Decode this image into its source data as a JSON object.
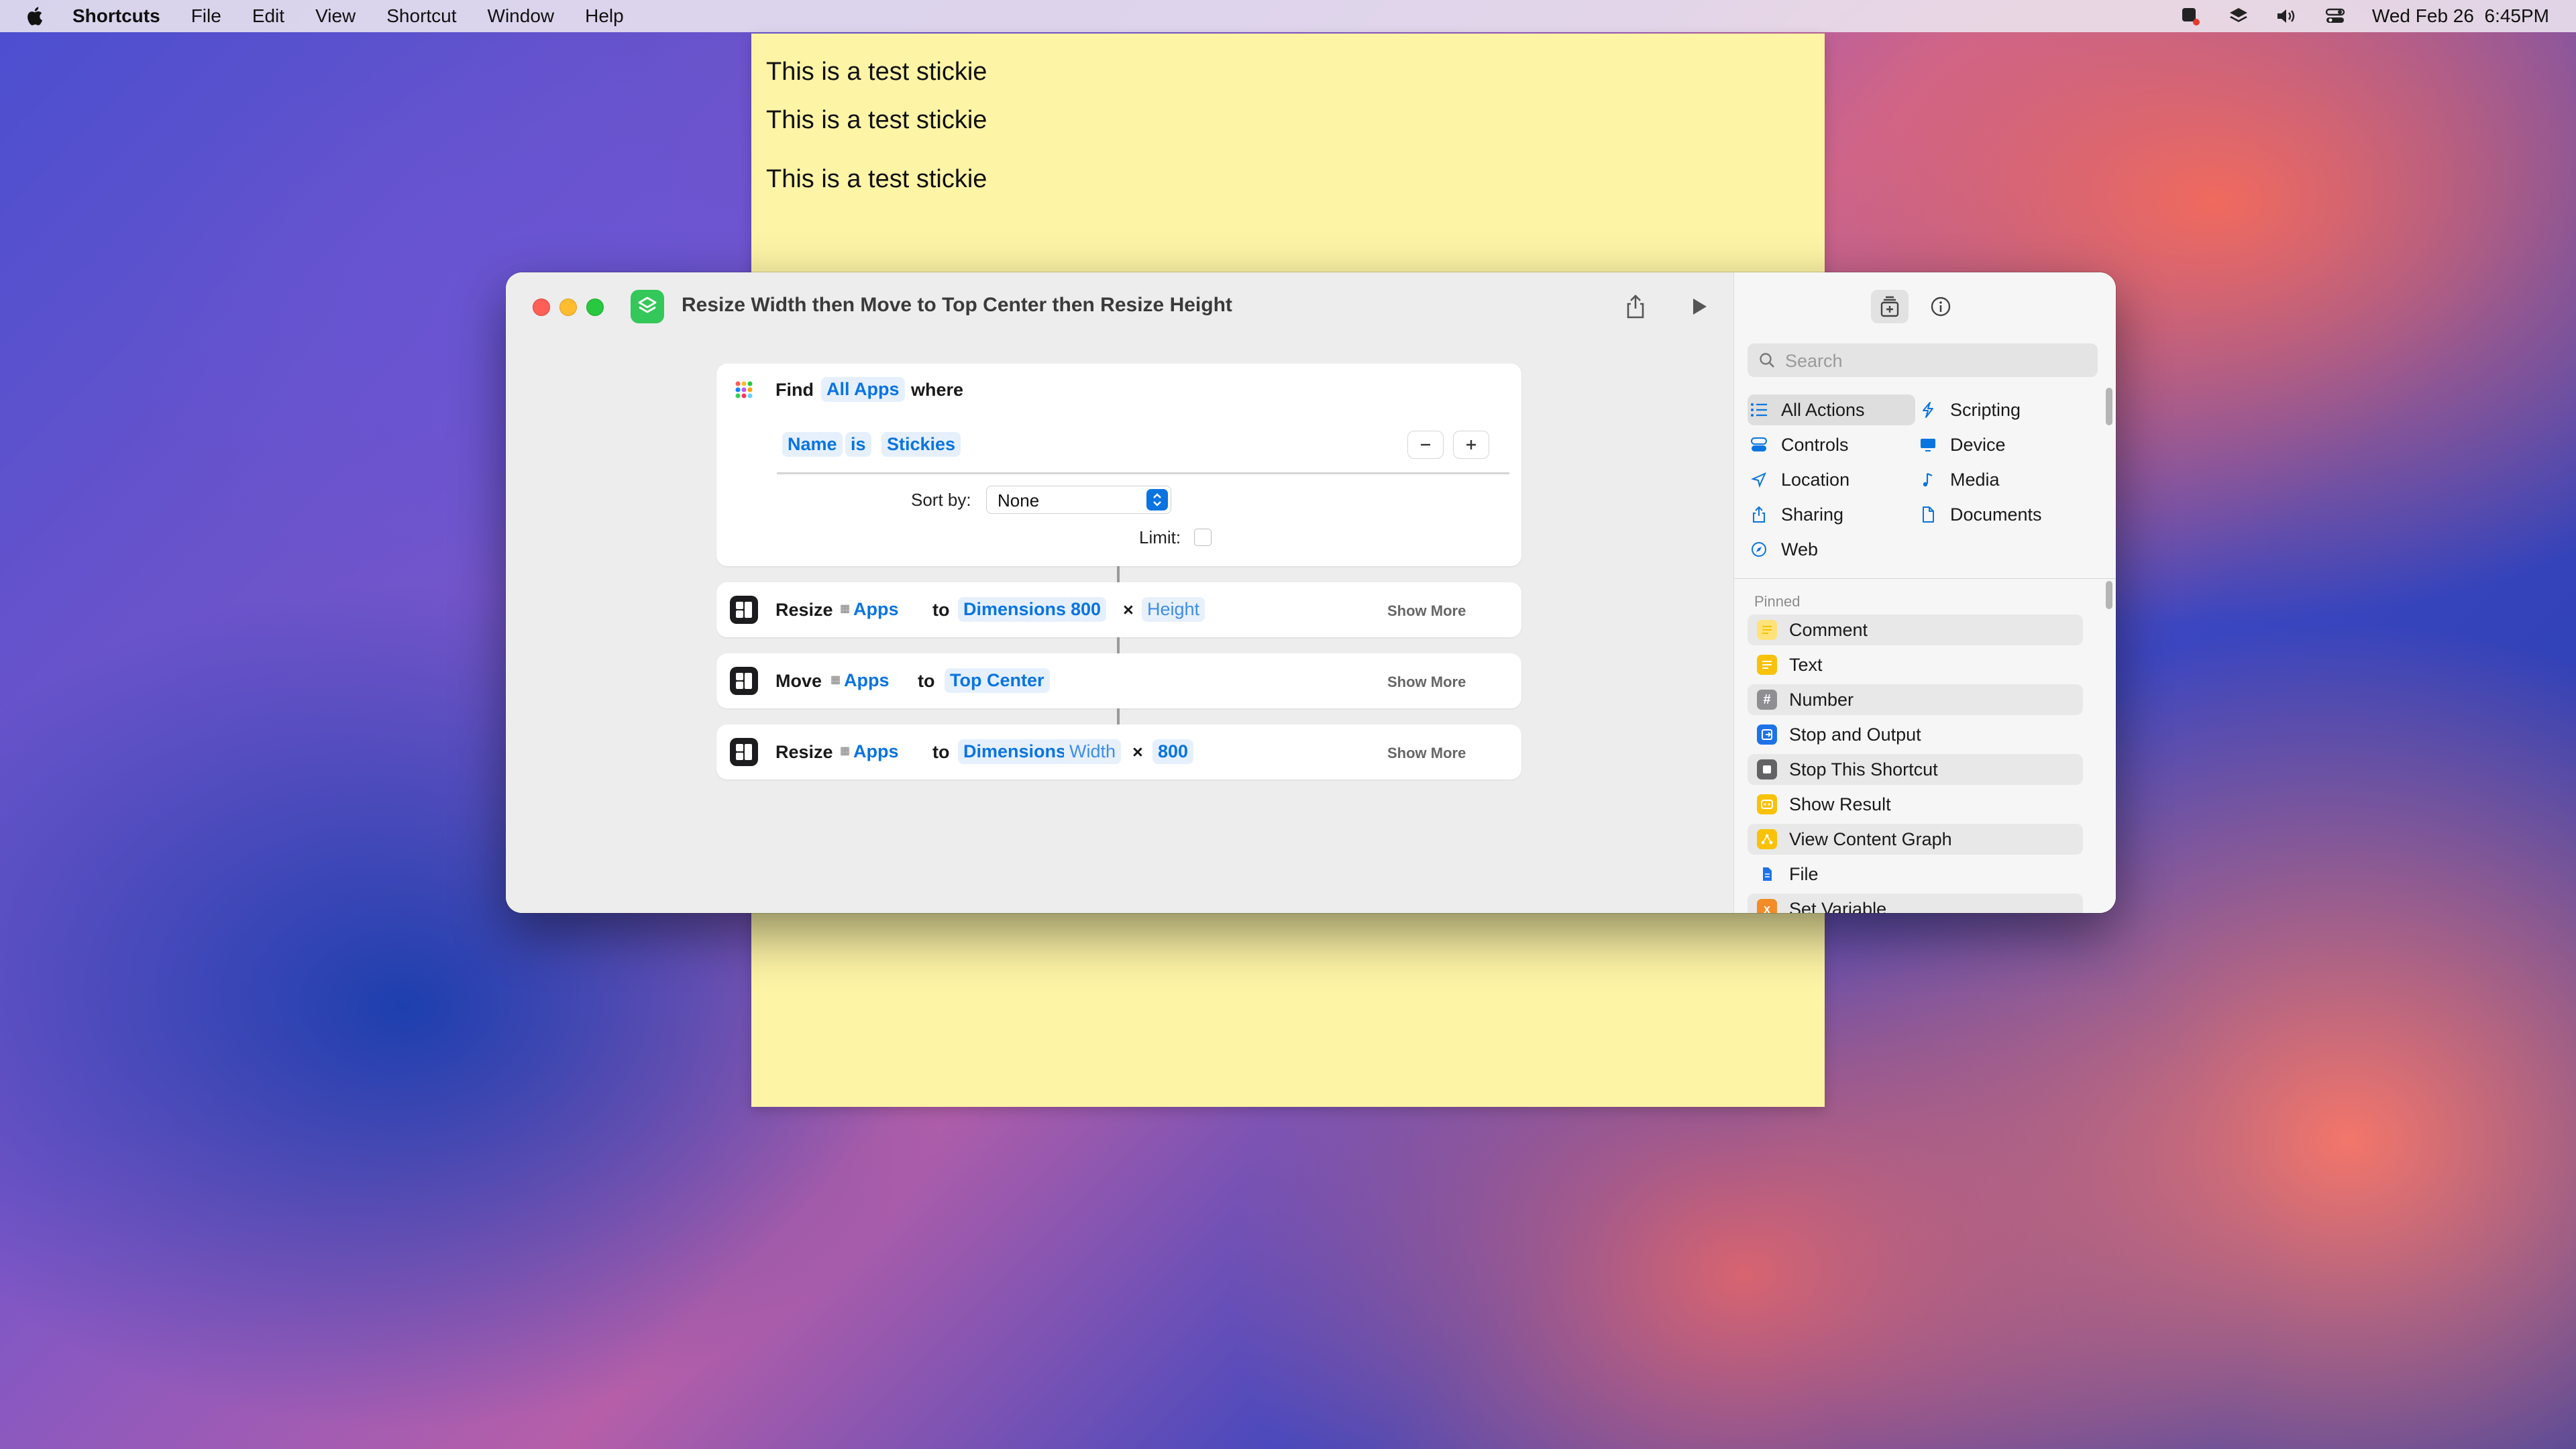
{
  "menubar": {
    "app_name": "Shortcuts",
    "items": [
      "File",
      "Edit",
      "View",
      "Shortcut",
      "Window",
      "Help"
    ],
    "datetime": "Wed Feb 26  6:45PM",
    "status_icons": [
      "shortcuts-status-icon",
      "layers-icon",
      "volume-icon",
      "control-center-icon"
    ]
  },
  "stickie": {
    "lines": [
      "This is a test stickie",
      "This is a test stickie",
      "This is a test stickie"
    ],
    "color": "#fdf4a6"
  },
  "window": {
    "title": "Resize Width then Move to Top Center then Resize Height"
  },
  "actions": {
    "find": {
      "verb": "Find",
      "scope": "All Apps",
      "where": "where",
      "filter": {
        "field": "Name",
        "op": "is",
        "value": "Stickies"
      },
      "sort_label": "Sort by:",
      "sort_value": "None",
      "limit_label": "Limit:"
    },
    "resize1": {
      "verb": "Resize",
      "target": "Apps",
      "to": "to",
      "mode": "Dimensions",
      "w": "800",
      "x": "×",
      "h": "Height",
      "more": "Show More"
    },
    "move": {
      "verb": "Move",
      "target": "Apps",
      "to": "to",
      "position": "Top Center",
      "more": "Show More"
    },
    "resize2": {
      "verb": "Resize",
      "target": "Apps",
      "to": "to",
      "mode": "Dimensions",
      "w": "Width",
      "x": "×",
      "h": "800",
      "more": "Show More"
    }
  },
  "sidebar": {
    "search_placeholder": "Search",
    "categories": {
      "all_actions": "All Actions",
      "scripting": "Scripting",
      "controls": "Controls",
      "device": "Device",
      "location": "Location",
      "media": "Media",
      "sharing": "Sharing",
      "documents": "Documents",
      "web": "Web"
    },
    "pinned_header": "Pinned",
    "pinned": {
      "comment": "Comment",
      "text": "Text",
      "number": "Number",
      "stop_output": "Stop and Output",
      "stop_shortcut": "Stop This Shortcut",
      "show_result": "Show Result",
      "view_graph": "View Content Graph",
      "file": "File",
      "set_variable": "Set Variable"
    }
  },
  "colors": {
    "accent": "#0a74e0",
    "shortcuts_green": "#34c759",
    "close": "#ff5f57",
    "minimize": "#febc2e",
    "maximize": "#28c840"
  }
}
